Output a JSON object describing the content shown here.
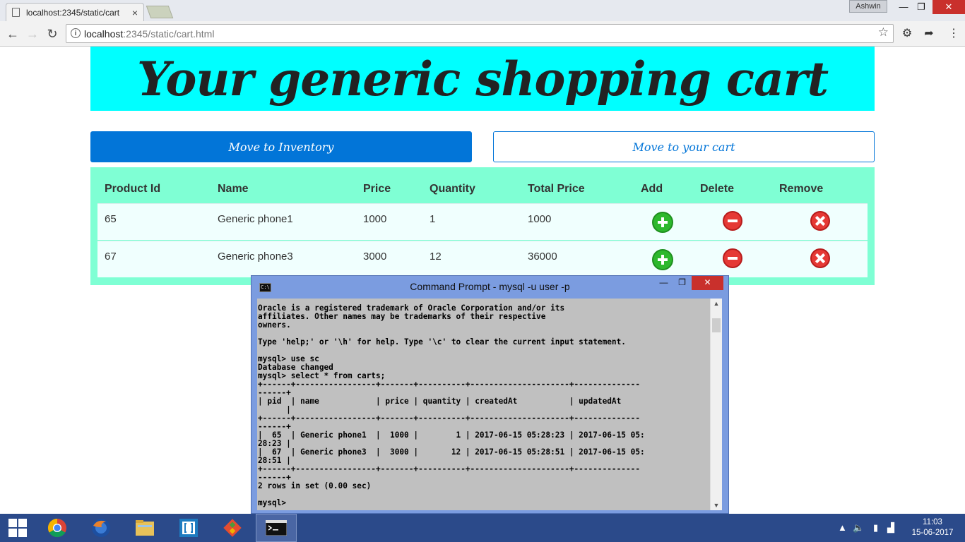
{
  "browser": {
    "tab_title": "localhost:2345/static/cart",
    "tab_close": "×",
    "profile_name": "Ashwin",
    "url_host": "localhost",
    "url_rest": ":2345/static/cart.html",
    "window_minimize": "—",
    "window_restore": "❐",
    "window_close": "✕"
  },
  "page": {
    "banner_title": "Your generic shopping cart",
    "buttons": {
      "inventory": "Move to Inventory",
      "cart": "Move to your cart"
    },
    "table": {
      "headers": [
        "Product Id",
        "Name",
        "Price",
        "Quantity",
        "Total Price",
        "Add",
        "Delete",
        "Remove"
      ],
      "rows": [
        {
          "product_id": "65",
          "name": "Generic phone1",
          "price": "1000",
          "quantity": "1",
          "total": "1000"
        },
        {
          "product_id": "67",
          "name": "Generic phone3",
          "price": "3000",
          "quantity": "12",
          "total": "36000"
        }
      ]
    }
  },
  "cmd": {
    "title": "Command Prompt - mysql  -u user -p",
    "icon_text": "C:\\",
    "lines": [
      "Oracle is a registered trademark of Oracle Corporation and/or its",
      "affiliates. Other names may be trademarks of their respective",
      "owners.",
      "",
      "Type 'help;' or '\\h' for help. Type '\\c' to clear the current input statement.",
      "",
      "mysql> use sc",
      "Database changed",
      "mysql> select * from carts;",
      "+------+-----------------+-------+----------+---------------------+--------------",
      "------+",
      "| pid  | name            | price | quantity | createdAt           | updatedAt",
      "      |",
      "+------+-----------------+-------+----------+---------------------+--------------",
      "------+",
      "|  65  | Generic phone1  |  1000 |        1 | 2017-06-15 05:28:23 | 2017-06-15 05:",
      "28:23 |",
      "|  67  | Generic phone3  |  3000 |       12 | 2017-06-15 05:28:51 | 2017-06-15 05:",
      "28:51 |",
      "+------+-----------------+-------+----------+---------------------+--------------",
      "------+",
      "2 rows in set (0.00 sec)",
      "",
      "mysql>"
    ]
  },
  "taskbar": {
    "time": "11:03",
    "date": "15-06-2017"
  },
  "colors": {
    "banner": "#00ffff",
    "cart_bg": "#7fffd4",
    "primary": "#0275d8",
    "add": "#2db82d",
    "delete": "#e53935"
  }
}
